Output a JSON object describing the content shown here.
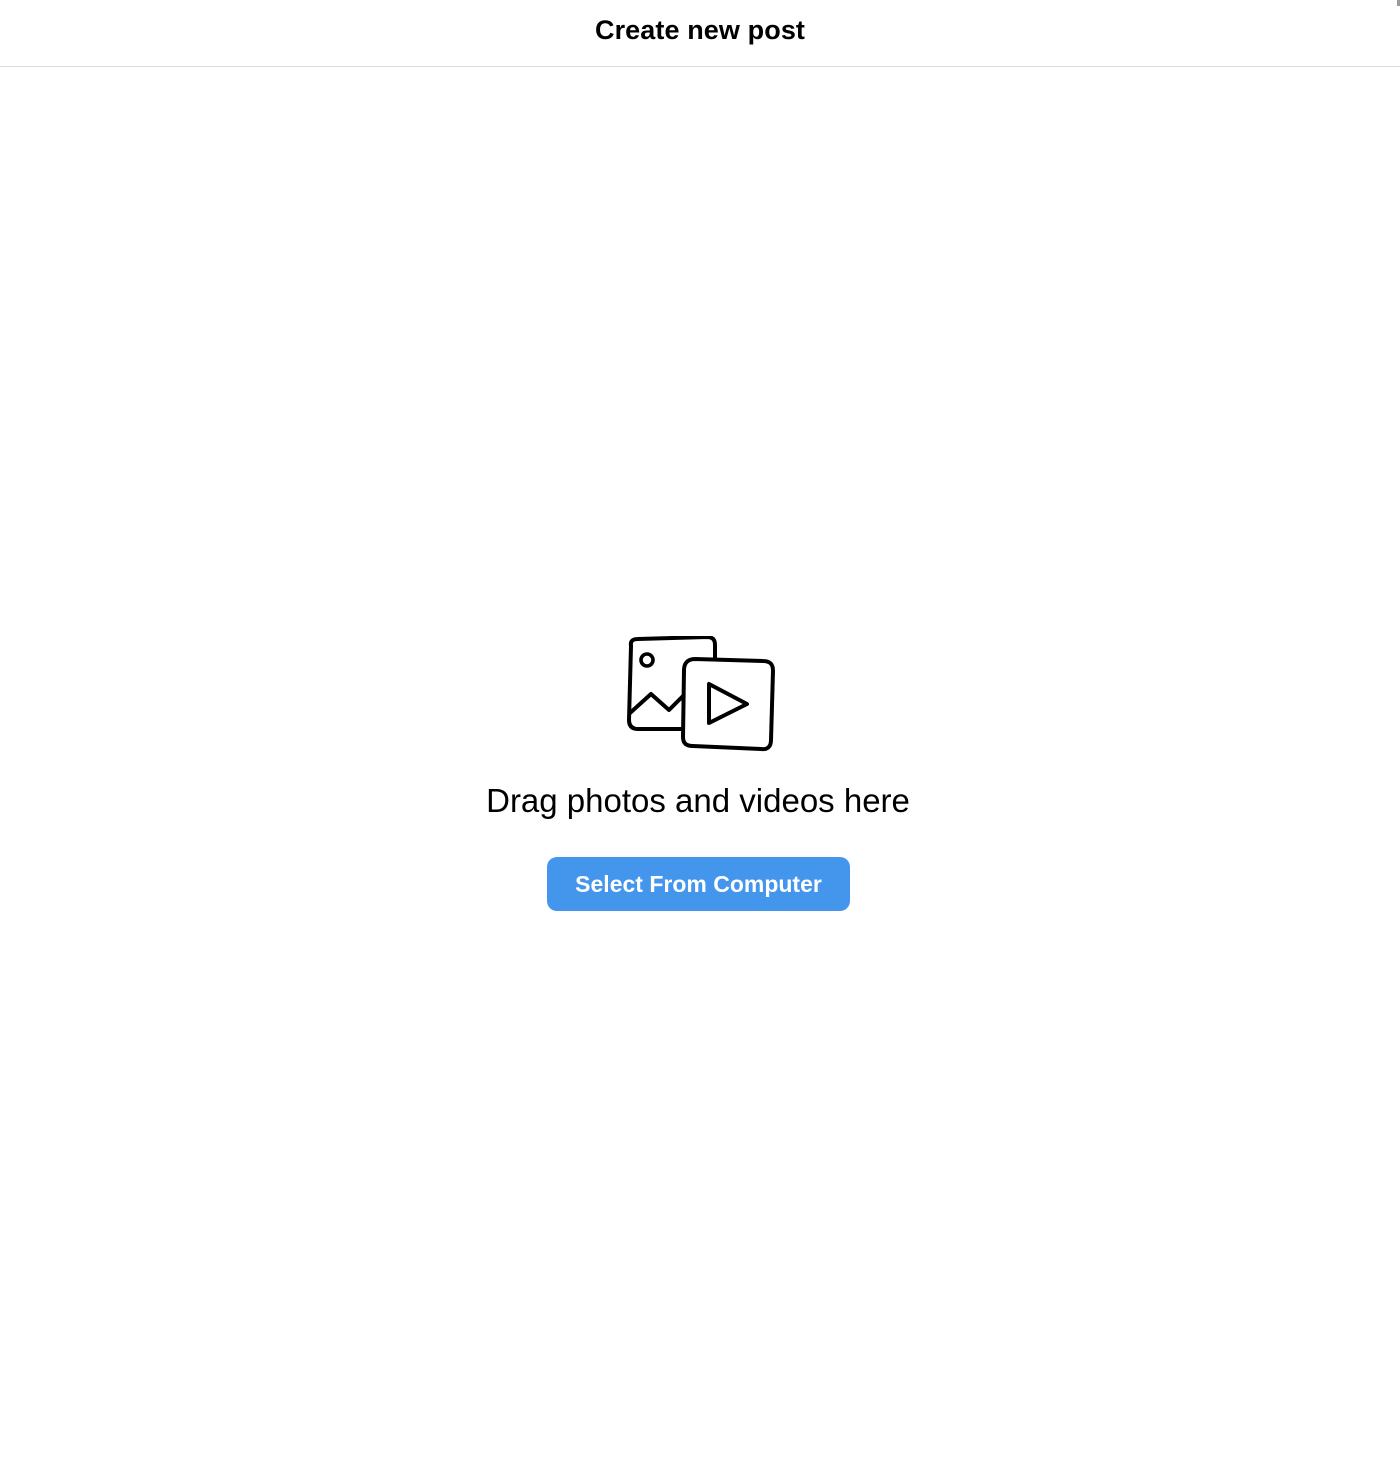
{
  "header": {
    "title": "Create new post"
  },
  "upload": {
    "icon": "photo-video-icon",
    "prompt": "Drag photos and videos here",
    "button_label": "Select From Computer"
  },
  "colors": {
    "button_background": "#4396EC",
    "button_text": "#FFFFFF",
    "divider": "#DBDBDB",
    "text": "#000000"
  }
}
